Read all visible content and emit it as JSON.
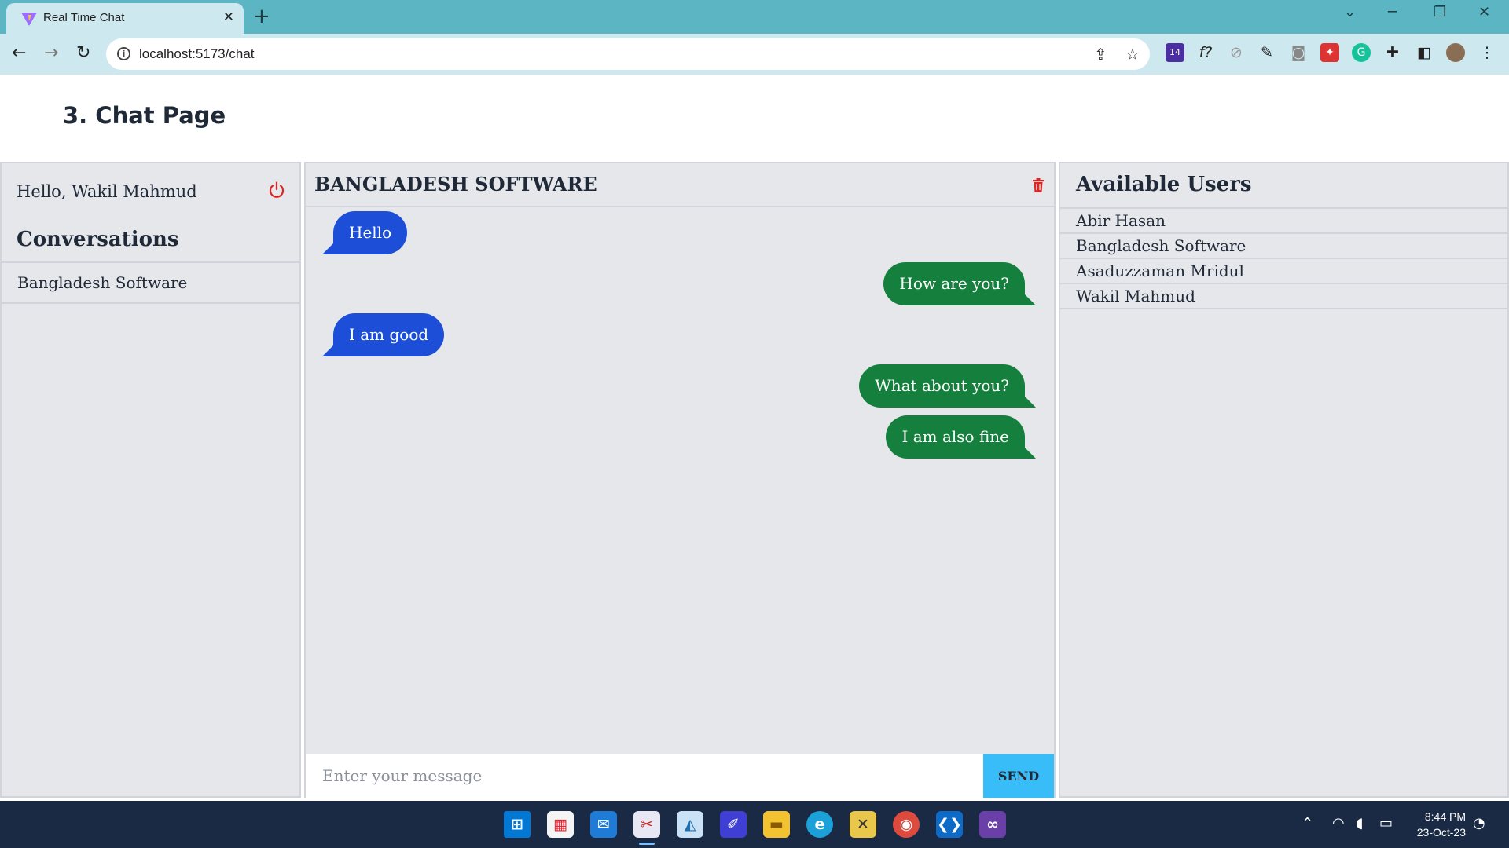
{
  "browser": {
    "tab_title": "Real Time Chat",
    "url": "localhost:5173/chat",
    "extension_badge": "14",
    "extension_fx": "f?"
  },
  "page": {
    "title": "3. Chat Page"
  },
  "sidebar": {
    "greeting": "Hello, Wakil Mahmud",
    "conversations_heading": "Conversations",
    "conversations": [
      "Bangladesh Software"
    ]
  },
  "chat": {
    "title": "BANGLADESH SOFTWARE",
    "messages": [
      {
        "text": "Hello",
        "direction": "incoming"
      },
      {
        "text": "How are you?",
        "direction": "outgoing"
      },
      {
        "text": "I am good",
        "direction": "incoming"
      },
      {
        "text": "What about you?",
        "direction": "outgoing"
      },
      {
        "text": "I am also fine",
        "direction": "outgoing"
      }
    ],
    "input_placeholder": "Enter your message",
    "send_label": "SEND",
    "colors": {
      "incoming": "#1d4ed8",
      "outgoing": "#15803d",
      "send": "#38bdf8",
      "delete": "#dc2626"
    }
  },
  "users": {
    "heading": "Available Users",
    "list": [
      "Abir Hasan",
      "Bangladesh Software",
      "Asaduzzaman Mridul",
      "Wakil Mahmud"
    ]
  },
  "taskbar": {
    "time": "8:44 PM",
    "date": "23-Oct-23"
  }
}
